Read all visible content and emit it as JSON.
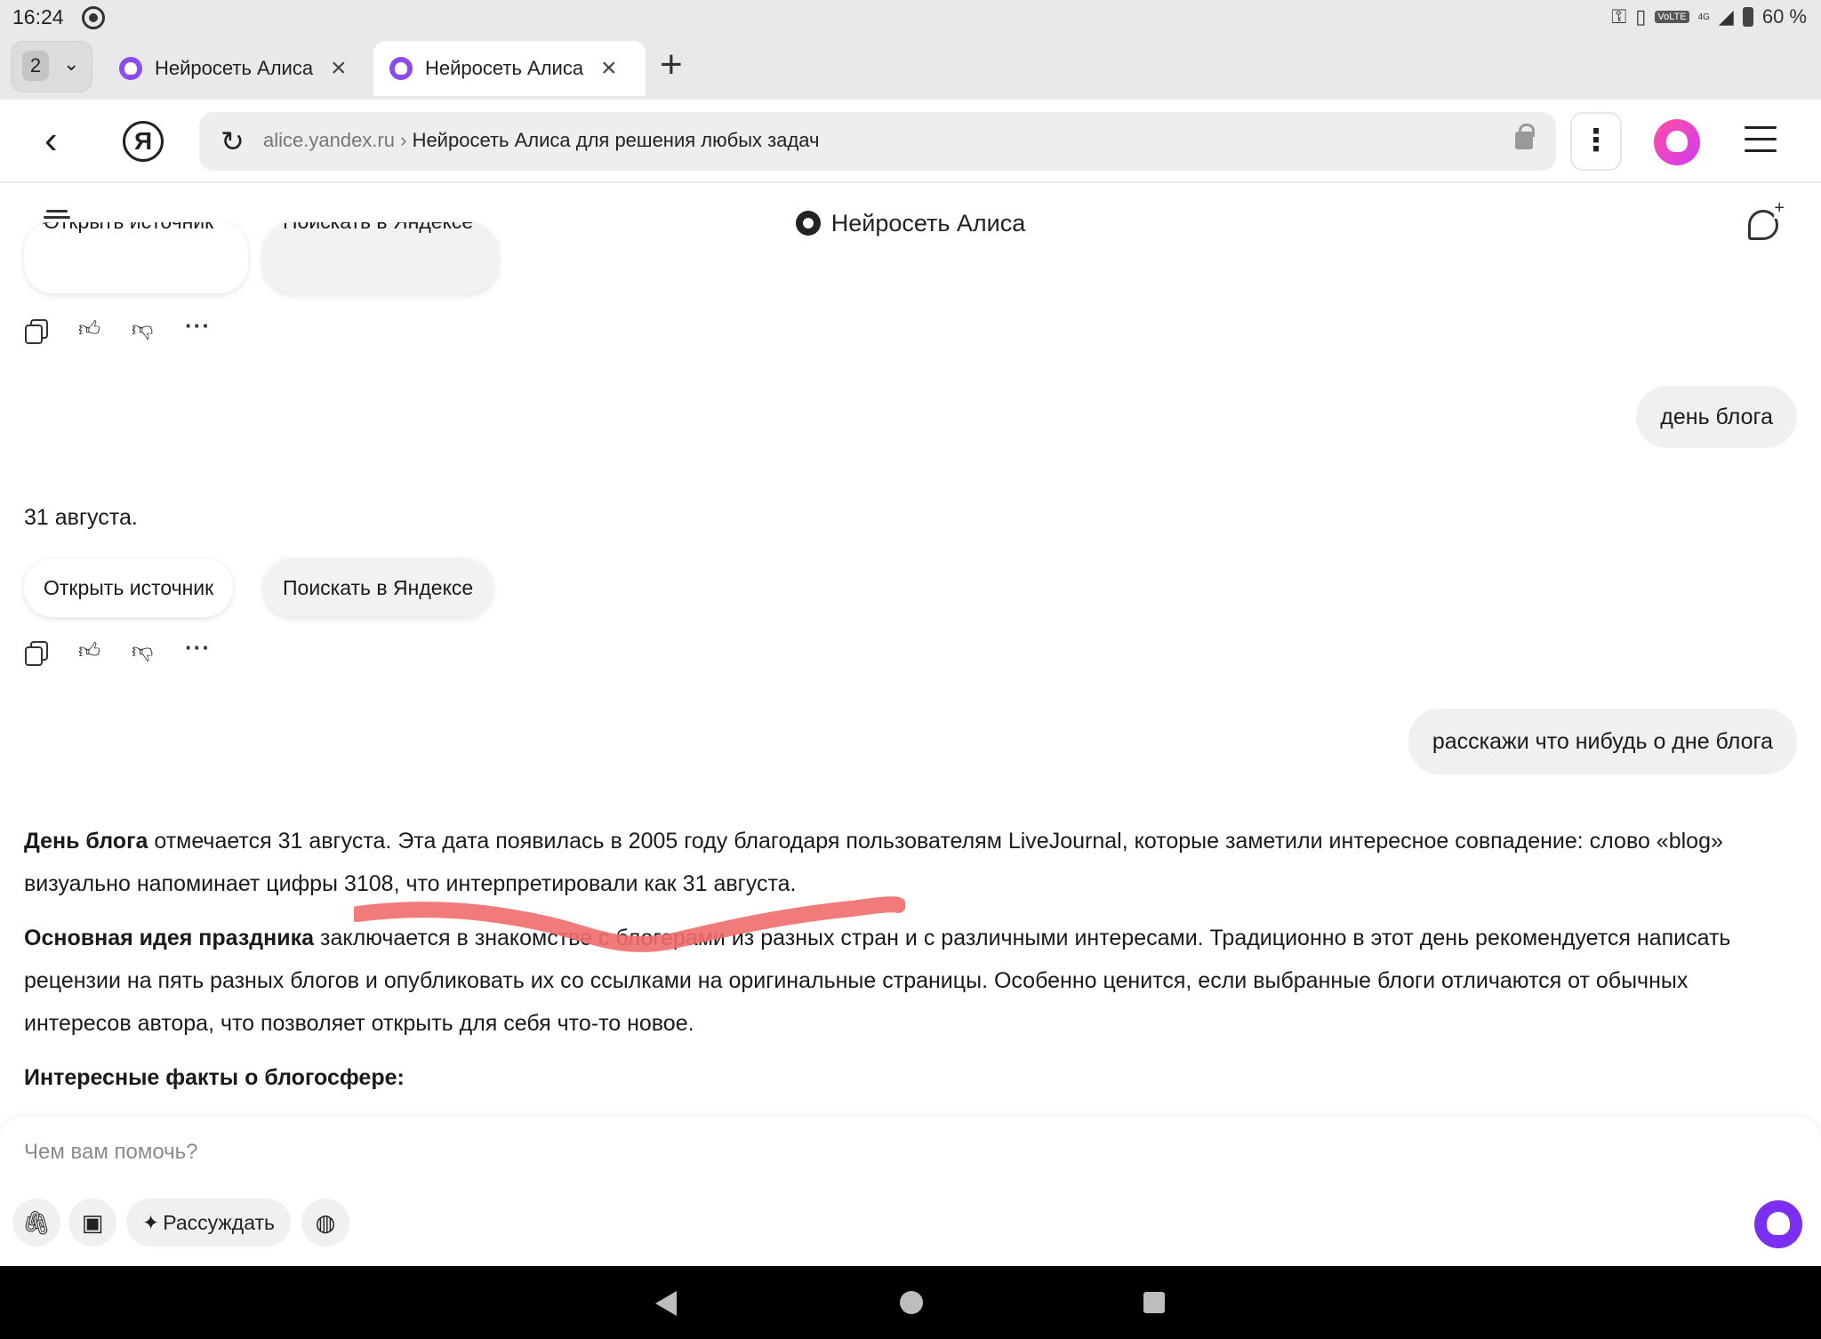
{
  "status_bar": {
    "time": "16:24",
    "network": "VoLTE",
    "signal_label": "4G",
    "battery": "60 %"
  },
  "tabs": {
    "count": "2",
    "items": [
      {
        "title": "Нейросеть Алиса",
        "active": false
      },
      {
        "title": "Нейросеть Алиса",
        "active": true
      }
    ]
  },
  "omnibox": {
    "domain": "alice.yandex.ru",
    "separator": "›",
    "page_title": "Нейросеть Алиса для решения любых задач"
  },
  "nav": {
    "back_glyph": "‹",
    "ya_logo": "Я"
  },
  "header": {
    "title": "Нейросеть Алиса"
  },
  "chat": {
    "first_answer_buttons": [
      "Открыть источник",
      "Поискать в Яндексе"
    ],
    "user_message_1": "день блога",
    "answer_1": "31 августа.",
    "answer_1_buttons": {
      "open_source": "Открыть источник",
      "search_yandex": "Поискать в Яндексе"
    },
    "user_message_2": "расскажи что нибудь о дне блога",
    "answer_2": {
      "p1_bold": "День блога",
      "p1_rest": " отмечается 31 августа. Эта дата появилась в 2005 году благодаря пользователям LiveJournal, которые заметили интересное совпадение: слово «blog» визуально напоминает цифры 3108, что интерпретировали как 31 августа.",
      "p2_bold": "Основная идея праздника",
      "p2_rest": " заключается в знакомстве с блогерами из разных стран и с различными интересами. Традиционно в этот день рекомендуется написать рецензии на пять разных блогов и опубликовать их со ссылками на оригинальные страницы. Особенно ценится, если выбранные блоги отличаются от обычных интересов автора, что позволяет открыть для себя что-то новое.",
      "p3_bold": "Интересные факты о блогосфере:"
    }
  },
  "composer": {
    "placeholder": "Чем вам помочь?",
    "reason_label": "Рассуждать"
  },
  "colors": {
    "accent": "#7b2ff2",
    "alice_gradient_start": "#ff4fa3",
    "scribble": "#f06b6b",
    "bubble_bg": "#f0f0f0"
  }
}
